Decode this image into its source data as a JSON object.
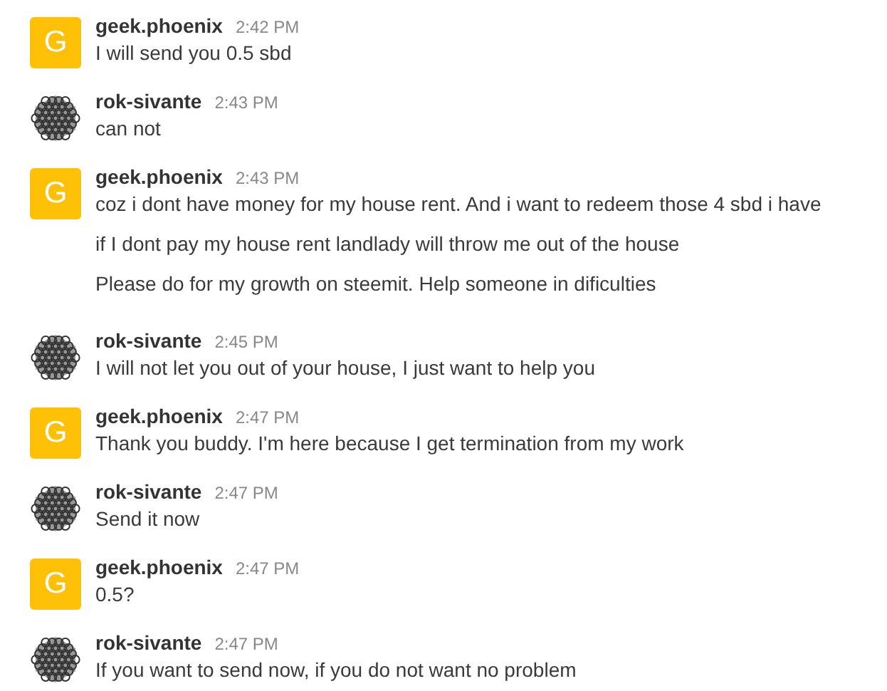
{
  "messages": [
    {
      "author": "geek.phoenix",
      "avatar": {
        "kind": "letter",
        "letter": "G"
      },
      "time": "2:42 PM",
      "lines": [
        "I will send you 0.5 sbd"
      ]
    },
    {
      "author": "rok-sivante",
      "avatar": {
        "kind": "pattern"
      },
      "time": "2:43 PM",
      "lines": [
        "can not"
      ]
    },
    {
      "author": "geek.phoenix",
      "avatar": {
        "kind": "letter",
        "letter": "G"
      },
      "time": "2:43 PM",
      "lines": [
        "coz i dont have money for my house rent. And i want to redeem those 4 sbd i have",
        "if I dont pay my house rent landlady will throw me out of the house",
        "Please do for my growth on steemit. Help someone in dificulties"
      ]
    },
    {
      "author": "rok-sivante",
      "avatar": {
        "kind": "pattern"
      },
      "time": "2:45 PM",
      "lines": [
        "I will not let you out of your house, I just want to help you"
      ]
    },
    {
      "author": "geek.phoenix",
      "avatar": {
        "kind": "letter",
        "letter": "G"
      },
      "time": "2:47 PM",
      "lines": [
        "Thank you buddy. I'm here because I get termination from my work"
      ]
    },
    {
      "author": "rok-sivante",
      "avatar": {
        "kind": "pattern"
      },
      "time": "2:47 PM",
      "lines": [
        "Send it now"
      ]
    },
    {
      "author": "geek.phoenix",
      "avatar": {
        "kind": "letter",
        "letter": "G"
      },
      "time": "2:47 PM",
      "lines": [
        "0.5?"
      ]
    },
    {
      "author": "rok-sivante",
      "avatar": {
        "kind": "pattern"
      },
      "time": "2:47 PM",
      "lines": [
        "If you want to send now, if you do not want no problem"
      ]
    }
  ]
}
